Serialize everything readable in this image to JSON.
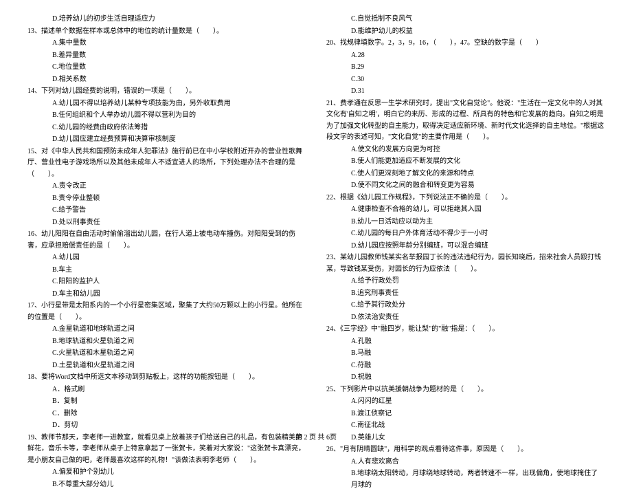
{
  "left_column": [
    {
      "type": "option",
      "text": "D.培养幼儿的初步生活自理适应力"
    },
    {
      "type": "question",
      "text": "13、描述单个数据在样本或总体中的地位的统计量数是（　　）。"
    },
    {
      "type": "option",
      "text": "A.集中量数"
    },
    {
      "type": "option",
      "text": "B.差异量数"
    },
    {
      "type": "option",
      "text": "C.地位量数"
    },
    {
      "type": "option",
      "text": "D.相关系数"
    },
    {
      "type": "question",
      "text": "14、下列对幼儿园经费的说明，错误的一项是（　　）。"
    },
    {
      "type": "option",
      "text": "A.幼儿园不得以培养幼儿某种专项技能为由，另外收取费用"
    },
    {
      "type": "option",
      "text": "B.任何组织和个人举办幼儿园不得以营利为目的"
    },
    {
      "type": "option",
      "text": "C.幼儿园的经费由政府依法筹措"
    },
    {
      "type": "option",
      "text": "D.幼儿园应建立经费预算和决算审核制度"
    },
    {
      "type": "question",
      "text": "15、对《中华人民共和国预防未成年人犯罪法》施行前已在中小学校附近开办的营业性歌舞厅、营业性电子游戏场所以及其他未成年人不适宜进人的场所，下列处理办法不合理的是（　　）。"
    },
    {
      "type": "option",
      "text": "A.责令改正"
    },
    {
      "type": "option",
      "text": "B.责令停业整顿"
    },
    {
      "type": "option",
      "text": "C.给予警告"
    },
    {
      "type": "option",
      "text": "D.处以刑事责任"
    },
    {
      "type": "question",
      "text": "16、幼儿阳阳在自由活动时偷偷溜出幼儿园，在行人道上被电动车撞伤。对阳阳受到的伤害，应承担赔偿责任的是（　　）。"
    },
    {
      "type": "option",
      "text": "A.幼儿园"
    },
    {
      "type": "option",
      "text": "B.车主"
    },
    {
      "type": "option",
      "text": "C.阳阳的监护人"
    },
    {
      "type": "option",
      "text": "D.车主和幼儿园"
    },
    {
      "type": "question",
      "text": "17、小行星带是太阳系内的一个小行星密集区域，聚集了大约50万颗以上的小行星。他所在的位置是（　　）。"
    },
    {
      "type": "option",
      "text": "A.金星轨道和地球轨道之间"
    },
    {
      "type": "option",
      "text": "B.地球轨道和火星轨道之间"
    },
    {
      "type": "option",
      "text": "C.火星轨道和木星轨道之间"
    },
    {
      "type": "option",
      "text": "D.土星轨道和火星轨道之间"
    },
    {
      "type": "question",
      "text": "18、要将Word文档中所选文本移动到剪贴板上，这样的功能按钮是（　　）。"
    },
    {
      "type": "option",
      "text": "A．格式刷"
    },
    {
      "type": "option",
      "text": "B．复制"
    },
    {
      "type": "option",
      "text": "C．删除"
    },
    {
      "type": "option",
      "text": "D．剪切"
    },
    {
      "type": "question",
      "text": "19、教师节那天，李老师一进教室，就看见桌上放着孩子们给送自己的礼品，有包装精美的鲜花，音乐卡等，李老师从桌子上特意拿起了一张贺卡，笑着对大家说：\"这张贺卡真漂亮，是小朋友自己做的吧，老师最喜欢这样的礼物！\"该做法表明李老师（　　）。"
    },
    {
      "type": "option",
      "text": "A.偏爱和护个别幼儿"
    },
    {
      "type": "option",
      "text": "B.不尊重大部分幼儿"
    }
  ],
  "right_column": [
    {
      "type": "option",
      "text": "C.自觉抵制不良风气"
    },
    {
      "type": "option",
      "text": "D.能维护幼儿的权益"
    },
    {
      "type": "question",
      "text": "20、找规律填数字。2，3，9，16，（　　），47。空缺的数字是（　　）"
    },
    {
      "type": "option",
      "text": "A.28"
    },
    {
      "type": "option",
      "text": "B.29"
    },
    {
      "type": "option",
      "text": "C.30"
    },
    {
      "type": "option",
      "text": "D.31"
    },
    {
      "type": "question",
      "text": "21、费孝通在反思一生学术研究时，提出\"文化自觉论\"。他说：\"生活在一定文化中的人对其文化有'自知之明'，明白它的来历、形成的过程、所具有的特色和它发展的趋向。自知之明是为了加强文化转型的自主能力，取得决定适应新环境、新时代文化选择的自主地位。\"根据这段文字的表述可知，\"文化自觉\"的主要作用是（　　）。"
    },
    {
      "type": "option",
      "text": "A.使文化的发展方向更为可控"
    },
    {
      "type": "option",
      "text": "B.使人们能更加适应不断发展的文化"
    },
    {
      "type": "option",
      "text": "C.使人们更深刻地了解文化的来源和特点"
    },
    {
      "type": "option",
      "text": "D.使不同文化之间的融合和转变更为容易"
    },
    {
      "type": "question",
      "text": "22、根据《幼儿园工作规程》，下列说法正不确的是（　　）。"
    },
    {
      "type": "option",
      "text": "A.健康检查不合格的幼儿，可以拒绝其入园"
    },
    {
      "type": "option",
      "text": "B.幼儿一日活动应以动为主"
    },
    {
      "type": "option",
      "text": "C.幼儿园的每日户外体育活动不得少于一小时"
    },
    {
      "type": "option",
      "text": "D.幼儿园应按照年龄分别编班，可以混合编班"
    },
    {
      "type": "question",
      "text": "23、某幼儿园教师钱某实名举报园丁长的违法违纪行为，园长知晓后，招来社会人员殴打钱某，导致钱某受伤，对园长的行为应依法（　　）。"
    },
    {
      "type": "option",
      "text": "A.给予行政处罚"
    },
    {
      "type": "option",
      "text": "B.追究刑事责任"
    },
    {
      "type": "option",
      "text": "C.给予其行政处分"
    },
    {
      "type": "option",
      "text": "D.依法治安责任"
    },
    {
      "type": "question",
      "text": "24、《三字经》中\"融四岁，能让梨\"的\"融\"指是：（　　）。"
    },
    {
      "type": "option",
      "text": "A.孔融"
    },
    {
      "type": "option",
      "text": "B.马融"
    },
    {
      "type": "option",
      "text": "C.苻融"
    },
    {
      "type": "option",
      "text": "D.祝融"
    },
    {
      "type": "question",
      "text": "25、下列影片中以抗美援朝战争为题材的是（　　）。"
    },
    {
      "type": "option",
      "text": "A.闪闪的红星"
    },
    {
      "type": "option",
      "text": "B.渡江侦察记"
    },
    {
      "type": "option",
      "text": "C.南征北战"
    },
    {
      "type": "option",
      "text": "D.英雄儿女"
    },
    {
      "type": "question",
      "text": "26、\"月有阴晴圆缺\"，用科学的观点看待这件事，原因是（　　）。"
    },
    {
      "type": "option",
      "text": "A.人有悲欢离合"
    },
    {
      "type": "option",
      "text": "B.地球绕太阳转动，月球绕地球转动，两者转速不一样，出现偏角，使地球掩住了月球的"
    }
  ],
  "footer": "第 2 页 共 6页"
}
